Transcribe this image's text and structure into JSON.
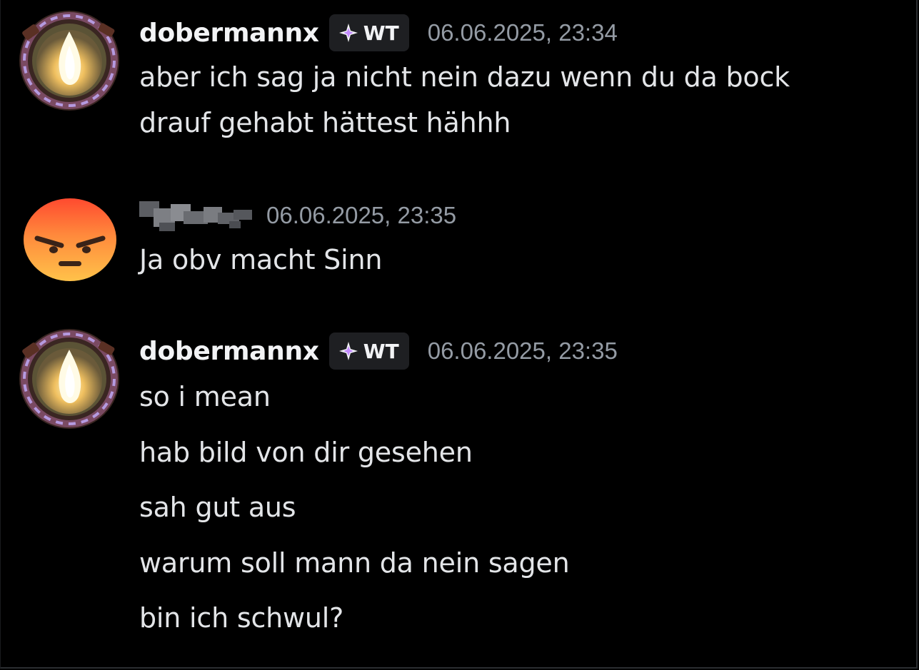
{
  "messages": [
    {
      "author": "dobermannx",
      "tag": "WT",
      "tag_icon": "sparkle-diamond-icon",
      "timestamp": "06.06.2025, 23:34",
      "avatar": "fire-portal-avatar",
      "lines": [
        "aber ich sag ja nicht nein dazu wenn du da bock",
        "drauf gehabt hättest hähhh"
      ]
    },
    {
      "author": "",
      "author_redacted": true,
      "timestamp": "06.06.2025, 23:35",
      "avatar": "angry-emoji-avatar",
      "lines": [
        "Ja obv macht Sinn"
      ]
    },
    {
      "author": "dobermannx",
      "tag": "WT",
      "tag_icon": "sparkle-diamond-icon",
      "timestamp": "06.06.2025, 23:35",
      "avatar": "fire-portal-avatar",
      "lines": [
        "so i mean",
        "hab bild von dir gesehen",
        "sah gut aus",
        "warum soll mann da nein sagen",
        "bin ich schwul?"
      ]
    }
  ],
  "colors": {
    "background": "#000000",
    "username": "#f2f3f5",
    "timestamp": "#949ba4",
    "message_text": "#e3e5e8",
    "tag_background": "#1e1f22",
    "tag_icon_accent": "#c48cff"
  }
}
